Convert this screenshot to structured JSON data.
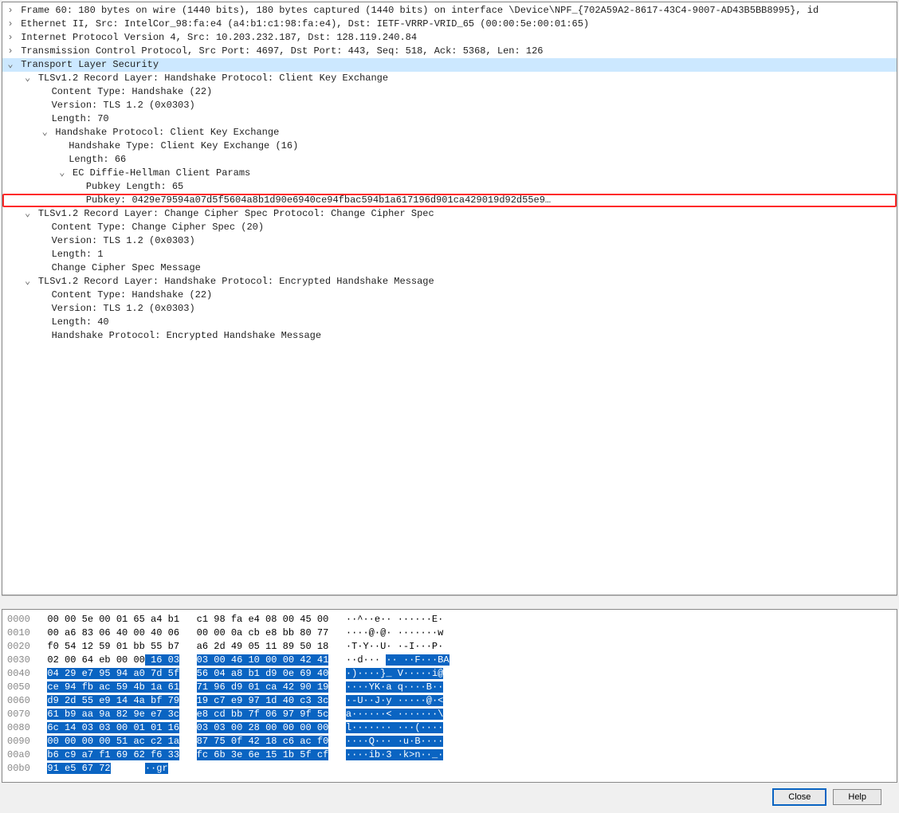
{
  "detail": {
    "frame": "Frame 60: 180 bytes on wire (1440 bits), 180 bytes captured (1440 bits) on interface \\Device\\NPF_{702A59A2-8617-43C4-9007-AD43B5BB8995}, id",
    "eth": "Ethernet II, Src: IntelCor_98:fa:e4 (a4:b1:c1:98:fa:e4), Dst: IETF-VRRP-VRID_65 (00:00:5e:00:01:65)",
    "ip": "Internet Protocol Version 4, Src: 10.203.232.187, Dst: 128.119.240.84",
    "tcp": "Transmission Control Protocol, Src Port: 4697, Dst Port: 443, Seq: 518, Ack: 5368, Len: 126",
    "tls": "Transport Layer Security",
    "rec1": "TLSv1.2 Record Layer: Handshake Protocol: Client Key Exchange",
    "ct1": "Content Type: Handshake (22)",
    "ver1": "Version: TLS 1.2 (0x0303)",
    "len1": "Length: 70",
    "hp": "Handshake Protocol: Client Key Exchange",
    "ht": "Handshake Type: Client Key Exchange (16)",
    "hl": "Length: 66",
    "ecdh": "EC Diffie-Hellman Client Params",
    "pklen": "Pubkey Length: 65",
    "pubkey": "Pubkey: 0429e79594a07d5f5604a8b1d90e6940ce94fbac594b1a617196d901ca429019d92d55e9…",
    "rec2": "TLSv1.2 Record Layer: Change Cipher Spec Protocol: Change Cipher Spec",
    "ct2": "Content Type: Change Cipher Spec (20)",
    "ver2": "Version: TLS 1.2 (0x0303)",
    "len2": "Length: 1",
    "ccsm": "Change Cipher Spec Message",
    "rec3": "TLSv1.2 Record Layer: Handshake Protocol: Encrypted Handshake Message",
    "ct3": "Content Type: Handshake (22)",
    "ver3": "Version: TLS 1.2 (0x0303)",
    "len3": "Length: 40",
    "ehm": "Handshake Protocol: Encrypted Handshake Message"
  },
  "hex": {
    "rows": [
      {
        "off": "0000",
        "h1": "00 00 5e 00 01 65 a4 b1",
        "h2": "c1 98 fa e4 08 00 45 00",
        "a": "··^··e·· ······E·",
        "sel1": 0,
        "sel2": 0
      },
      {
        "off": "0010",
        "h1": "00 a6 83 06 40 00 40 06",
        "h2": "00 00 0a cb e8 bb 80 77",
        "a": "····@·@· ·······w",
        "sel1": 0,
        "sel2": 0
      },
      {
        "off": "0020",
        "h1": "f0 54 12 59 01 bb 55 b7",
        "h2": "a6 2d 49 05 11 89 50 18",
        "a": "·T·Y··U· ·-I···P·",
        "sel1": 0,
        "sel2": 0
      },
      {
        "off": "0030",
        "h1": "02 00 64 eb 00 00",
        "h1b": " 16 03",
        "h2": "03 00 46 10 00 00 42 41",
        "a1": "··d··· ",
        "a2": "·· ··F···BA",
        "sel1": 2,
        "sel2": 1
      },
      {
        "off": "0040",
        "h1": "04 29 e7 95 94 a0 7d 5f",
        "h2": "56 04 a8 b1 d9 0e 69 40",
        "a": "·)····}_ V·····i@",
        "sel1": 1,
        "sel2": 1
      },
      {
        "off": "0050",
        "h1": "ce 94 fb ac 59 4b 1a 61",
        "h2": "71 96 d9 01 ca 42 90 19",
        "a": "····YK·a q····B··",
        "sel1": 1,
        "sel2": 1
      },
      {
        "off": "0060",
        "h1": "d9 2d 55 e9 14 4a bf 79",
        "h2": "19 c7 e9 97 1d 40 c3 3c",
        "a": "·-U··J·y ·····@·<",
        "sel1": 1,
        "sel2": 1
      },
      {
        "off": "0070",
        "h1": "61 b9 aa 9a 82 9e e7 3c",
        "h2": "e8 cd bb 7f 06 97 9f 5c",
        "a": "a······< ·······\\",
        "sel1": 1,
        "sel2": 1
      },
      {
        "off": "0080",
        "h1": "6c 14 03 03 00 01 01 16",
        "h2": "03 03 00 28 00 00 00 00",
        "a": "l······· ···(····",
        "sel1": 1,
        "sel2": 1
      },
      {
        "off": "0090",
        "h1": "00 00 00 00 51 ac c2 1a",
        "h2": "87 75 0f 42 18 c6 ac f0",
        "a": "····Q··· ·u·B····",
        "sel1": 1,
        "sel2": 1
      },
      {
        "off": "00a0",
        "h1": "b6 c9 a7 f1 69 62 f6 33",
        "h2": "fc 6b 3e 6e 15 1b 5f cf",
        "a": "····ib·3 ·k>n··_·",
        "sel1": 1,
        "sel2": 1
      },
      {
        "off": "00b0",
        "h1": "91 e5 67 72",
        "h2": "",
        "a": "··gr",
        "sel1": 1,
        "sel2": 0
      }
    ]
  },
  "buttons": {
    "close": "Close",
    "help": "Help"
  }
}
